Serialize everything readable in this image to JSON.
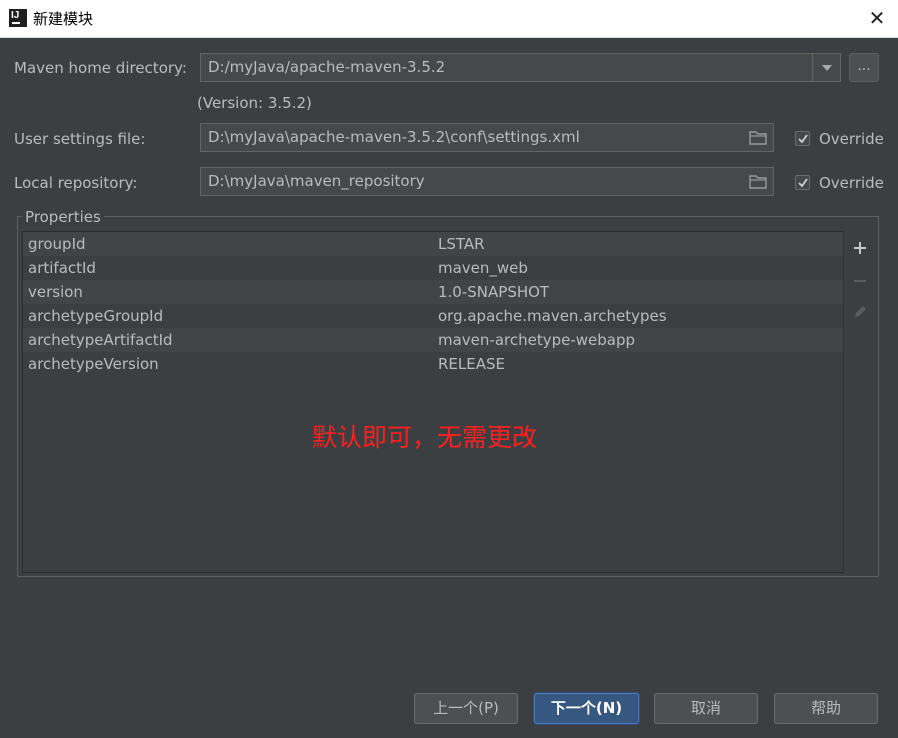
{
  "window": {
    "title": "新建模块",
    "app_icon": "IJ"
  },
  "form": {
    "maven_home_label": "Maven home directory:",
    "maven_home_value": "D:/myJava/apache-maven-3.5.2",
    "browse_label": "...",
    "version_note": "(Version: 3.5.2)",
    "user_settings_label": "User settings file:",
    "user_settings_value": "D:\\myJava\\apache-maven-3.5.2\\conf\\settings.xml",
    "local_repo_label": "Local repository:",
    "local_repo_value": "D:\\myJava\\maven_repository",
    "override_label": "Override",
    "override_settings_checked": true,
    "override_repo_checked": true
  },
  "properties": {
    "title": "Properties",
    "rows": [
      {
        "key": "groupId",
        "value": "LSTAR"
      },
      {
        "key": "artifactId",
        "value": "maven_web"
      },
      {
        "key": "version",
        "value": "1.0-SNAPSHOT"
      },
      {
        "key": "archetypeGroupId",
        "value": "org.apache.maven.archetypes"
      },
      {
        "key": "archetypeArtifactId",
        "value": "maven-archetype-webapp"
      },
      {
        "key": "archetypeVersion",
        "value": "RELEASE"
      }
    ],
    "tools": [
      "plus-icon",
      "minus-icon",
      "pencil-icon"
    ]
  },
  "annotation": "默认即可，无需更改",
  "buttons": {
    "previous": "上一个(P)",
    "next": "下一个(N)",
    "cancel": "取消",
    "help": "帮助"
  },
  "colors": {
    "background": "#3c3f41",
    "field": "#45494a",
    "primary_button": "#365880",
    "annotation": "#ff1f1f"
  }
}
